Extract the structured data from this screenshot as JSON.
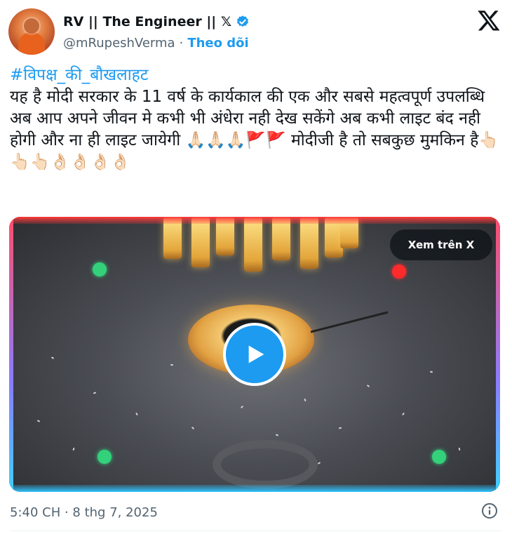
{
  "author": {
    "display_name": "RV || The Engineer || 𝕏",
    "handle": "@mRupeshVerma",
    "separator": "·",
    "follow_label": "Theo dõi",
    "verified": true
  },
  "tweet": {
    "hashtag": "#विपक्ष_की_बौखलाहट",
    "body": "यह है मोदी सरकार के 11 वर्ष के कार्यकाल की एक और सबसे महत्वपूर्ण उपलब्धि  अब आप अपने जीवन मे कभी भी अंधेरा नही देख सकेंगे अब कभी लाइट बंद नही होगी और ना ही लाइट जायेगी 🙏🏻🙏🏻🙏🏻🚩🚩 मोदीजी है तो सबकुछ मुमकिन है👆🏻👆🏻👆🏻👌🏻👌🏻👌🏻👌🏻"
  },
  "media": {
    "view_on_x_label": "Xem trên X"
  },
  "footer": {
    "timestamp": "5:40 CH · 8 thg 7, 2025"
  },
  "colors": {
    "accent": "#1d9bf0",
    "text": "#0f1419",
    "muted": "#536471"
  },
  "icons": [
    "verified-badge-icon",
    "x-logo-icon",
    "play-icon",
    "info-icon"
  ]
}
